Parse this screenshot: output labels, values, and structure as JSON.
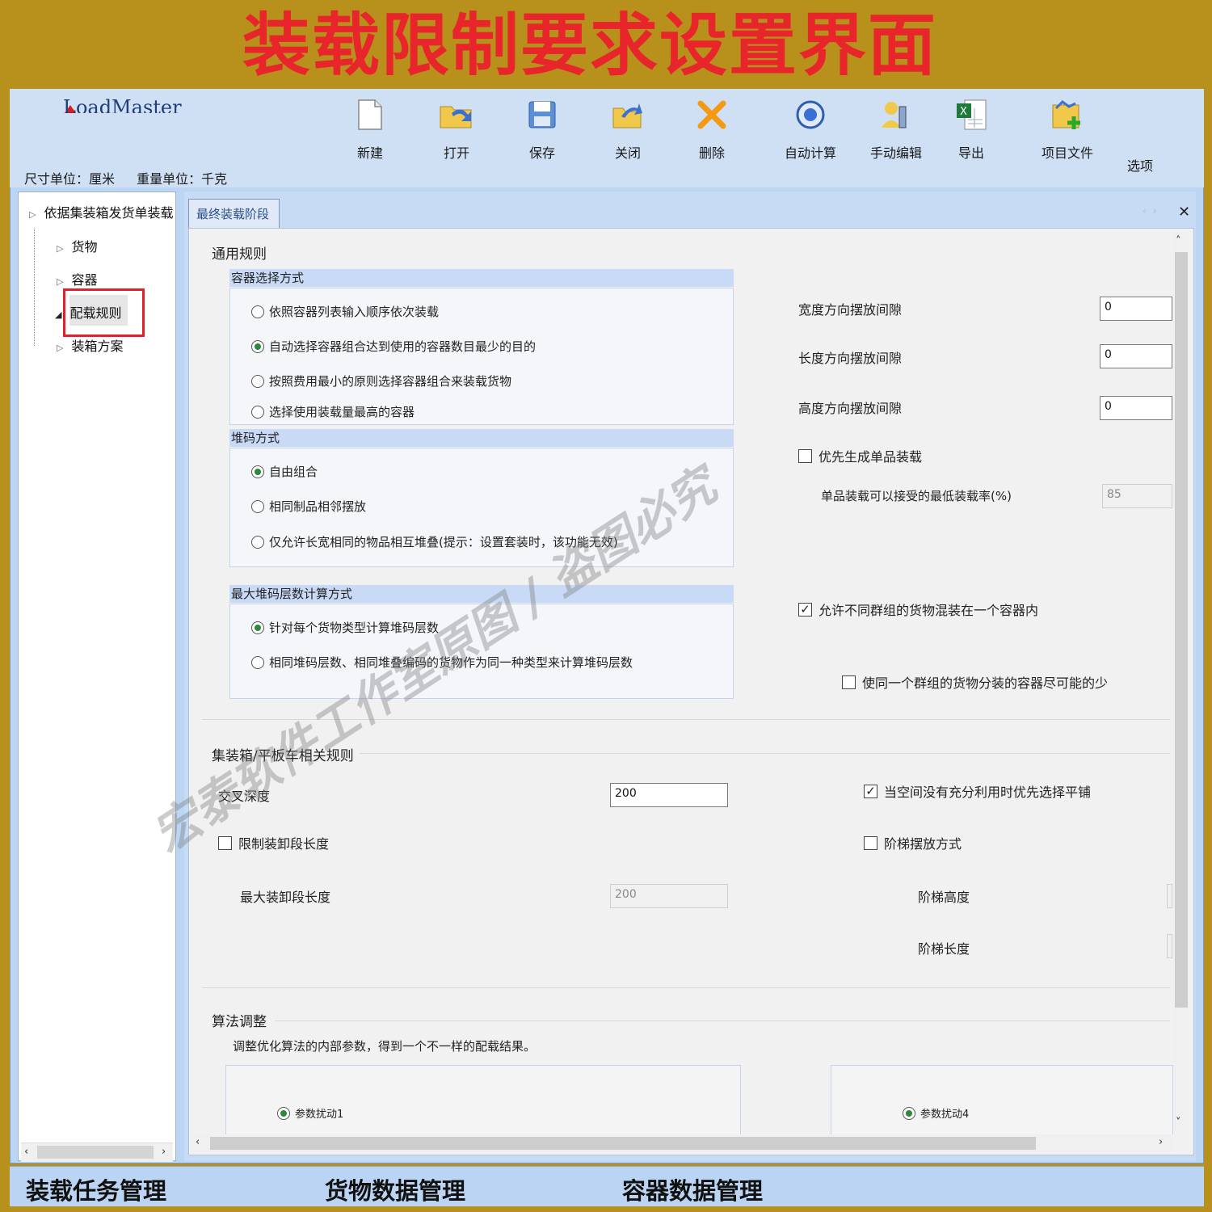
{
  "banner": {
    "title": "装载限制要求设置界面"
  },
  "app": {
    "logo": "LoadMaster"
  },
  "toolbar": {
    "new": "新建",
    "open": "打开",
    "save": "保存",
    "close": "关闭",
    "delete": "删除",
    "auto_calc": "自动计算",
    "manual_edit": "手动编辑",
    "export": "导出",
    "project_file": "项目文件",
    "options": "选项"
  },
  "units": {
    "size": "尺寸单位：厘米",
    "weight": "重量单位：千克"
  },
  "tree": {
    "root": "依据集装箱发货单装载",
    "items": [
      "货物",
      "容器",
      "配载规则",
      "装箱方案"
    ]
  },
  "tab": {
    "label": "最终装载阶段"
  },
  "general": {
    "title": "通用规则",
    "container_selection": {
      "header": "容器选择方式",
      "options": [
        "依照容器列表输入顺序依次装载",
        "自动选择容器组合达到使用的容器数目最少的目的",
        "按照费用最小的原则选择容器组合来装载货物",
        "选择使用装载量最高的容器"
      ],
      "selected": 1
    },
    "stacking": {
      "header": "堆码方式",
      "options": [
        "自由组合",
        "相同制品相邻摆放",
        "仅允许长宽相同的物品相互堆叠(提示：设置套装时，该功能无效)"
      ],
      "selected": 0
    },
    "max_layers": {
      "header": "最大堆码层数计算方式",
      "options": [
        "针对每个货物类型计算堆码层数",
        "相同堆码层数、相同堆叠编码的货物作为同一种类型来计算堆码层数"
      ],
      "selected": 0
    },
    "gap_width_label": "宽度方向摆放间隙",
    "gap_width": "0",
    "gap_length_label": "长度方向摆放间隙",
    "gap_length": "0",
    "gap_height_label": "高度方向摆放间隙",
    "gap_height": "0",
    "single_product_label": "优先生成单品装载",
    "single_product_checked": false,
    "min_rate_label": "单品装载可以接受的最低装载率(%)",
    "min_rate": "85",
    "mix_groups_label": "允许不同群组的货物混装在一个容器内",
    "mix_groups_checked": true,
    "min_containers_label": "使同一个群组的货物分装的容器尽可能的少",
    "min_containers_checked": false
  },
  "container_rules": {
    "title": "集装箱/平板车相关规则",
    "cross_depth_label": "交叉深度",
    "cross_depth": "200",
    "limit_section_label": "限制装卸段长度",
    "limit_section_checked": false,
    "max_section_label": "最大装卸段长度",
    "max_section": "200",
    "prefer_flat_label": "当空间没有充分利用时优先选择平铺",
    "prefer_flat_checked": true,
    "step_label": "阶梯摆放方式",
    "step_checked": false,
    "step_height_label": "阶梯高度",
    "step_length_label": "阶梯长度"
  },
  "algorithm": {
    "title": "算法调整",
    "description": "调整优化算法的内部参数，得到一个不一样的配载结果。",
    "param1": "参数扰动1",
    "param4": "参数扰动4"
  },
  "watermark": "宏泰软件工作室原图 / 盗图必究",
  "bottom_tabs": [
    "装载任务管理",
    "货物数据管理",
    "容器数据管理"
  ],
  "colors": {
    "banner_bg": "#b8901c",
    "banner_text": "#e8252a",
    "highlight": "#e0202a"
  }
}
